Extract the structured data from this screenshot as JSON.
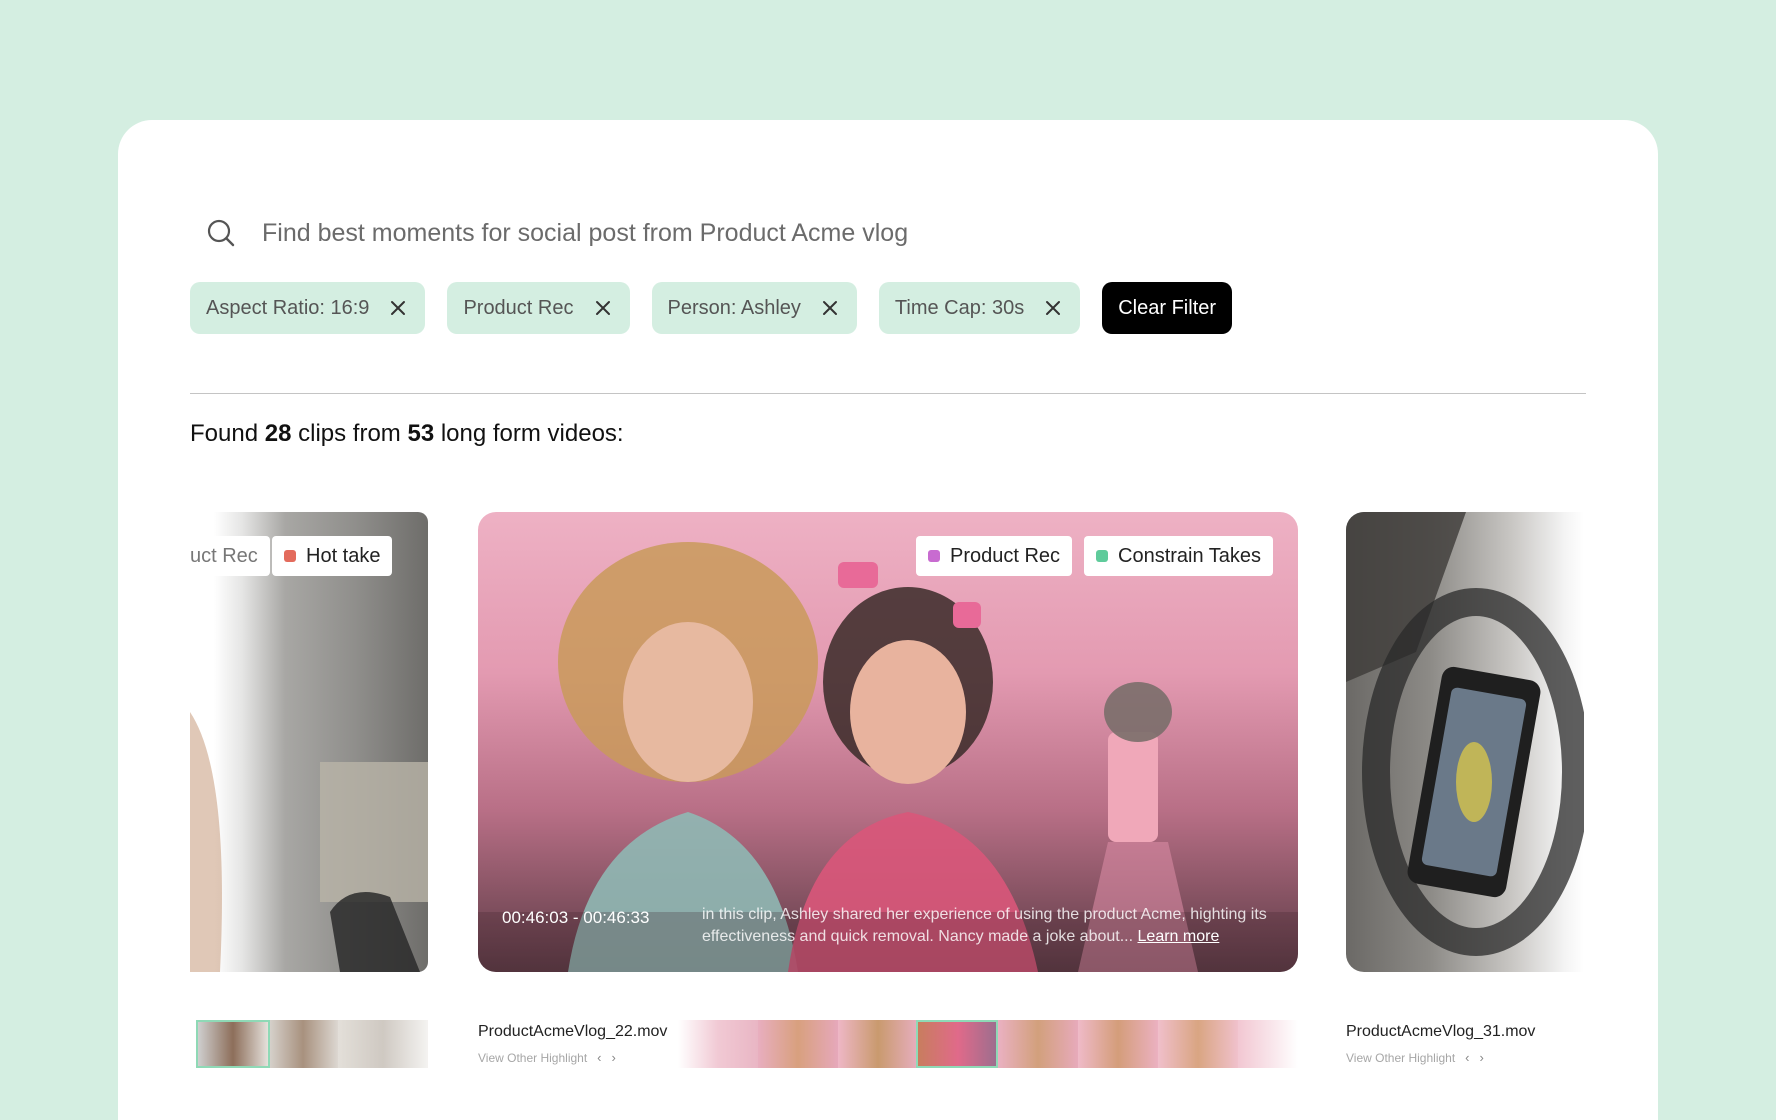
{
  "search": {
    "placeholder": "Find best moments for social post from Product Acme vlog"
  },
  "filters": [
    {
      "label": "Aspect Ratio: 16:9"
    },
    {
      "label": "Product Rec"
    },
    {
      "label": "Person: Ashley"
    },
    {
      "label": "Time Cap: 30s"
    }
  ],
  "clear_filter_label": "Clear Filter",
  "results": {
    "prefix": "Found",
    "clips": "28",
    "middle": "clips from",
    "videos": "53",
    "suffix": "long form videos:"
  },
  "clips": {
    "left": {
      "tags": [
        {
          "label": "uct Rec"
        },
        {
          "label": "Hot take",
          "color": "#e36b5c"
        }
      ]
    },
    "main": {
      "tags": [
        {
          "label": "Product Rec",
          "color": "#c86bd0"
        },
        {
          "label": "Constrain Takes",
          "color": "#5fcb9b"
        }
      ],
      "timecode": "00:46:03 - 00:46:33",
      "description": "in this clip, Ashley shared her experience of using the product Acme, highting its effectiveness and quick removal. Nancy made a joke about...",
      "learn_more": "Learn more",
      "filename": "ProductAcmeVlog_22.mov",
      "view_other": "View Other Highlight"
    },
    "right": {
      "filename": "ProductAcmeVlog_31.mov",
      "view_other": "View Other Highlight"
    }
  },
  "icons": {
    "search": "search-icon",
    "close": "close-icon",
    "chevron_left": "chevron-left-icon",
    "chevron_right": "chevron-right-icon"
  },
  "colors": {
    "background": "#d4eee1",
    "chip": "#d4eee1",
    "clear_button": "#000000",
    "selection": "#8fd9b6"
  }
}
